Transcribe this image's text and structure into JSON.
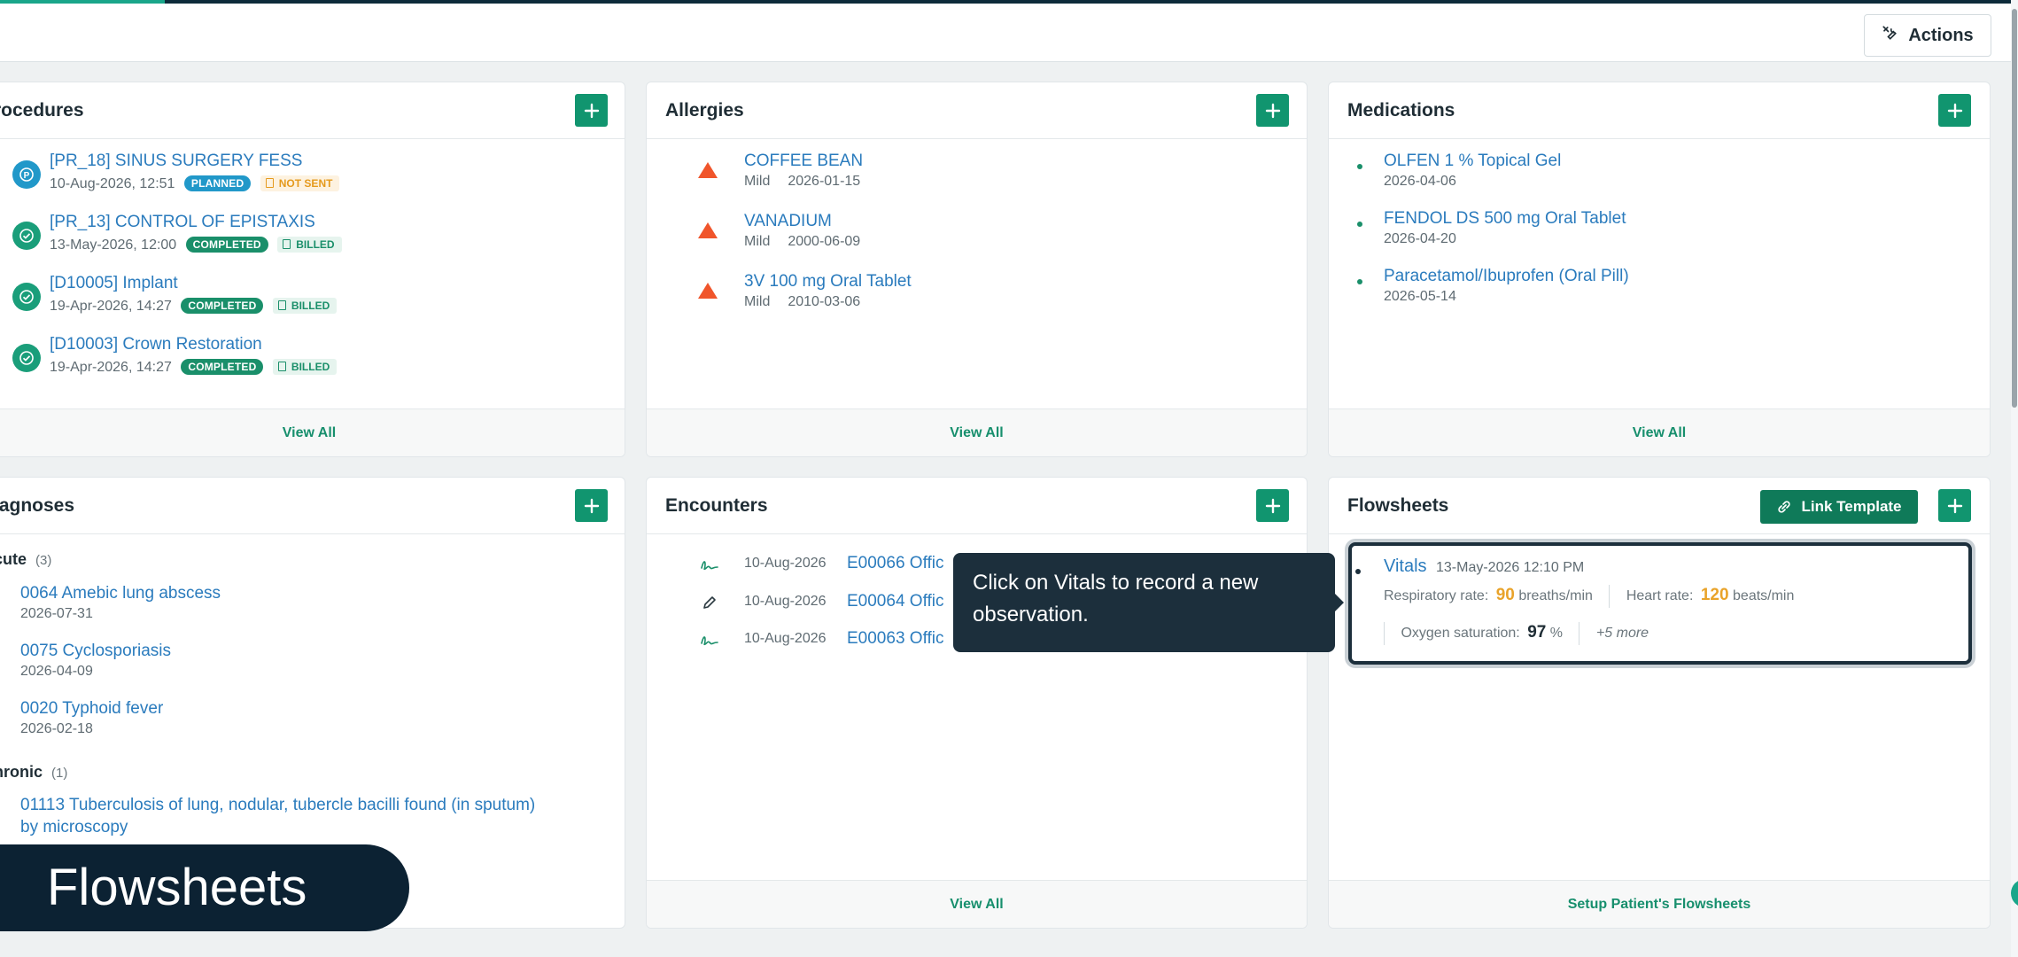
{
  "header": {
    "actions_label": "Actions"
  },
  "procedures": {
    "title": "rocedures",
    "items": [
      {
        "name": "[PR_18] SINUS SURGERY FESS",
        "datetime": "10-Aug-2026, 12:51",
        "status": "PLANNED",
        "billing": "NOT SENT"
      },
      {
        "name": "[PR_13] CONTROL OF EPISTAXIS",
        "datetime": "13-May-2026, 12:00",
        "status": "COMPLETED",
        "billing": "BILLED"
      },
      {
        "name": "[D10005] Implant",
        "datetime": "19-Apr-2026, 14:27",
        "status": "COMPLETED",
        "billing": "BILLED"
      },
      {
        "name": "[D10003] Crown Restoration",
        "datetime": "19-Apr-2026, 14:27",
        "status": "COMPLETED",
        "billing": "BILLED"
      }
    ],
    "footer": "View All"
  },
  "allergies": {
    "title": "Allergies",
    "items": [
      {
        "name": "COFFEE BEAN",
        "severity": "Mild",
        "date": "2026-01-15"
      },
      {
        "name": "VANADIUM",
        "severity": "Mild",
        "date": "2000-06-09"
      },
      {
        "name": "3V 100 mg Oral Tablet",
        "severity": "Mild",
        "date": "2010-03-06"
      }
    ],
    "footer": "View All"
  },
  "medications": {
    "title": "Medications",
    "items": [
      {
        "name": "OLFEN 1 % Topical Gel",
        "date": "2026-04-06"
      },
      {
        "name": "FENDOL DS 500 mg Oral Tablet",
        "date": "2026-04-20"
      },
      {
        "name": "Paracetamol/Ibuprofen (Oral Pill)",
        "date": "2026-05-14"
      }
    ],
    "footer": "View All"
  },
  "diagnoses": {
    "title": "iagnoses",
    "groups": [
      {
        "label": "cute",
        "count": "(3)"
      },
      {
        "label": "hronic",
        "count": "(1)"
      }
    ],
    "acute_items": [
      {
        "name": "0064 Amebic lung abscess",
        "date": "2026-07-31"
      },
      {
        "name": "0075 Cyclosporiasis",
        "date": "2026-04-09"
      },
      {
        "name": "0020 Typhoid fever",
        "date": "2026-02-18"
      }
    ],
    "chronic_item": {
      "line1": "01113 Tuberculosis of lung, nodular, tubercle bacilli found (in sputum)",
      "line2": "by microscopy"
    }
  },
  "encounters": {
    "title": "Encounters",
    "items": [
      {
        "date": "10-Aug-2026",
        "code": "E00066 Offic",
        "icon": "signature-icon"
      },
      {
        "date": "10-Aug-2026",
        "code": "E00064 Offic",
        "icon": "pencil-icon"
      },
      {
        "date": "10-Aug-2026",
        "code": "E00063 Offic",
        "icon": "signature-icon"
      }
    ],
    "footer": "View All"
  },
  "flowsheets": {
    "title": "Flowsheets",
    "link_template_label": "Link Template",
    "vitals": {
      "name": "Vitals",
      "datetime": "13-May-2026 12:10 PM",
      "respiratory_label": "Respiratory rate:",
      "respiratory_value": "90",
      "respiratory_unit": "breaths/min",
      "heart_label": "Heart rate:",
      "heart_value": "120",
      "heart_unit": "beats/min",
      "oxygen_label": "Oxygen saturation:",
      "oxygen_value": "97",
      "oxygen_unit": "%",
      "more": "+5 more"
    },
    "footer": "Setup Patient's Flowsheets"
  },
  "tooltip": {
    "text": "Click on Vitals to record a new observation."
  },
  "caption": {
    "text": "Flowsheets"
  },
  "colors": {
    "accent_green": "#11956f",
    "link_blue": "#2a7bbd",
    "warning_orange": "#e9a32a",
    "allergy_red": "#f0552b",
    "navy": "#1c2f3c"
  }
}
